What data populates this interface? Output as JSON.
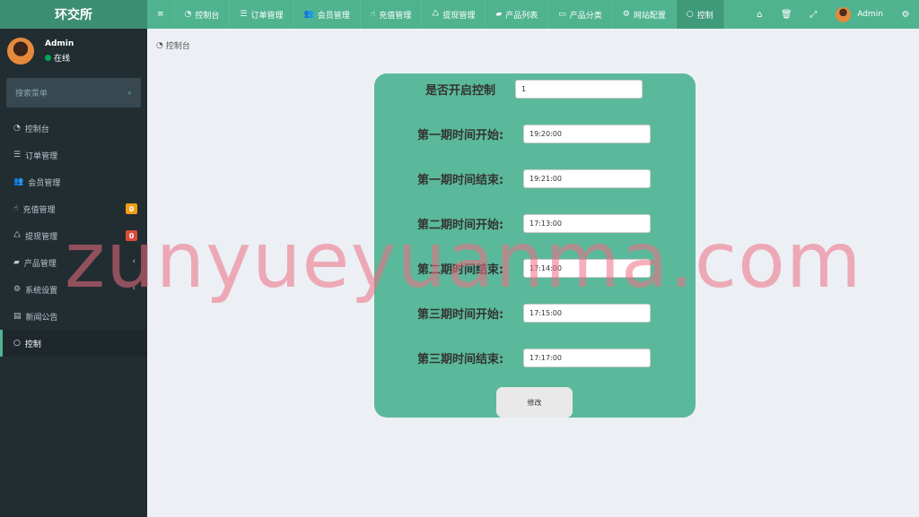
{
  "brand": "环交所",
  "topnav": [
    {
      "icon": "≡",
      "label": ""
    },
    {
      "icon": "◔",
      "label": "控制台"
    },
    {
      "icon": "☰",
      "label": "订单管理"
    },
    {
      "icon": "👥",
      "label": "会员管理"
    },
    {
      "icon": "☝",
      "label": "充值管理"
    },
    {
      "icon": "♺",
      "label": "提现管理"
    },
    {
      "icon": "▰",
      "label": "产品列表"
    },
    {
      "icon": "▭",
      "label": "产品分类"
    },
    {
      "icon": "⚙",
      "label": "网站配置"
    },
    {
      "icon": "○",
      "label": "控制"
    }
  ],
  "header_right": {
    "home_icon": "⌂",
    "trash_icon": "🗑",
    "fullscreen_icon": "⤢",
    "user": "Admin",
    "settings_icon": "⚙"
  },
  "user": {
    "name": "Admin",
    "status": "在线"
  },
  "search": {
    "placeholder": "搜索菜单",
    "icon": "⌕"
  },
  "menu": [
    {
      "icon": "◔",
      "label": "控制台"
    },
    {
      "icon": "☰",
      "label": "订单管理"
    },
    {
      "icon": "👥",
      "label": "会员管理"
    },
    {
      "icon": "☝",
      "label": "充值管理",
      "badge": "0"
    },
    {
      "icon": "♺",
      "label": "提现管理",
      "badge": "0"
    },
    {
      "icon": "▰",
      "label": "产品管理",
      "chevron": "‹"
    },
    {
      "icon": "⚙",
      "label": "系统设置",
      "chevron": "‹"
    },
    {
      "icon": "▤",
      "label": "新闻公告"
    },
    {
      "icon": "○",
      "label": "控制"
    }
  ],
  "breadcrumb": {
    "icon": "◔",
    "label": "控制台"
  },
  "form": {
    "fields": [
      {
        "label": "是否开启控制",
        "value": "1"
      },
      {
        "label": "第一期时间开始:",
        "value": "19:20:00"
      },
      {
        "label": "第一期时间结束:",
        "value": "19:21:00"
      },
      {
        "label": "第二期时间开始:",
        "value": "17:13:00"
      },
      {
        "label": "第二期时间结束:",
        "value": "17:14:00"
      },
      {
        "label": "第三期时间开始:",
        "value": "17:15:00"
      },
      {
        "label": "第三期时间结束:",
        "value": "17:17:00"
      }
    ],
    "submit": "修改"
  },
  "watermark": "zunyueyuanma.com",
  "colors": {
    "accent": "#4fb38f",
    "brand": "#3c8e73",
    "panel": "#5bb99b",
    "sidebar": "#222d32"
  }
}
